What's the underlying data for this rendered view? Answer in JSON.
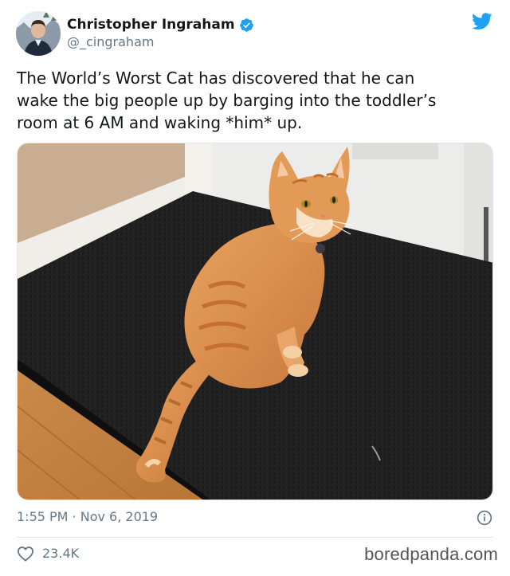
{
  "author": {
    "display_name": "Christopher Ingraham",
    "handle": "@_cingraham",
    "verified": true
  },
  "tweet": {
    "text": "The World’s Worst Cat has discovered that he can\nwake the big people up by barging into the toddler’s\nroom at 6 AM and waking *him* up.",
    "timestamp": "1:55 PM · Nov 6, 2019",
    "likes": "23.4K"
  },
  "icons": {
    "verified": "verified-badge-icon",
    "brand": "twitter-bird-icon",
    "info": "info-icon",
    "like": "heart-icon"
  },
  "colors": {
    "brand_blue": "#1da1f2",
    "secondary_text": "#657786",
    "primary_text": "#14171a"
  },
  "watermark": "boredpanda.com"
}
